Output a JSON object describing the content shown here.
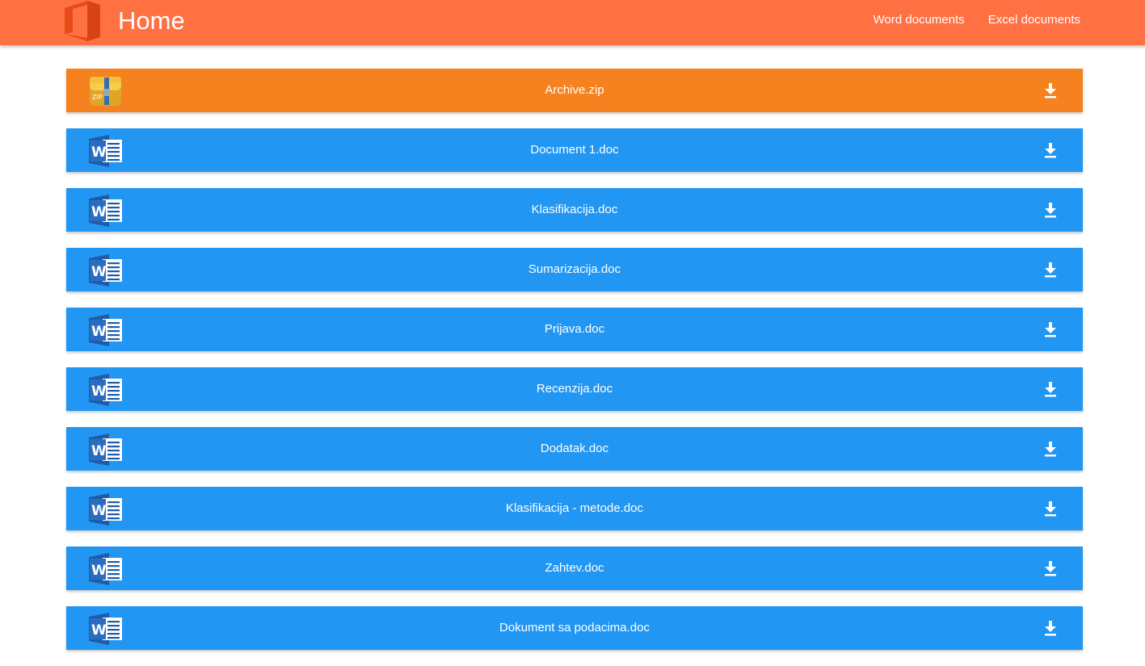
{
  "header": {
    "title": "Home",
    "logo_icon": "office-logo-icon",
    "color": "#ff7043",
    "nav": [
      {
        "label": "Word documents"
      },
      {
        "label": "Excel documents"
      }
    ]
  },
  "files": [
    {
      "name": "Archive.zip",
      "type": "zip",
      "color": "#f5821f",
      "icon": "zip-archive-icon",
      "action_icon": "download-icon"
    },
    {
      "name": "Document 1.doc",
      "type": "doc",
      "color": "#2196f3",
      "icon": "word-doc-icon",
      "action_icon": "download-icon"
    },
    {
      "name": "Klasifikacija.doc",
      "type": "doc",
      "color": "#2196f3",
      "icon": "word-doc-icon",
      "action_icon": "download-icon"
    },
    {
      "name": "Sumarizacija.doc",
      "type": "doc",
      "color": "#2196f3",
      "icon": "word-doc-icon",
      "action_icon": "download-icon"
    },
    {
      "name": "Prijava.doc",
      "type": "doc",
      "color": "#2196f3",
      "icon": "word-doc-icon",
      "action_icon": "download-icon"
    },
    {
      "name": "Recenzija.doc",
      "type": "doc",
      "color": "#2196f3",
      "icon": "word-doc-icon",
      "action_icon": "download-icon"
    },
    {
      "name": "Dodatak.doc",
      "type": "doc",
      "color": "#2196f3",
      "icon": "word-doc-icon",
      "action_icon": "download-icon"
    },
    {
      "name": "Klasifikacija - metode.doc",
      "type": "doc",
      "color": "#2196f3",
      "icon": "word-doc-icon",
      "action_icon": "download-icon"
    },
    {
      "name": "Zahtev.doc",
      "type": "doc",
      "color": "#2196f3",
      "icon": "word-doc-icon",
      "action_icon": "download-icon"
    },
    {
      "name": "Dokument sa podacima.doc",
      "type": "doc",
      "color": "#2196f3",
      "icon": "word-doc-icon",
      "action_icon": "download-icon"
    }
  ]
}
